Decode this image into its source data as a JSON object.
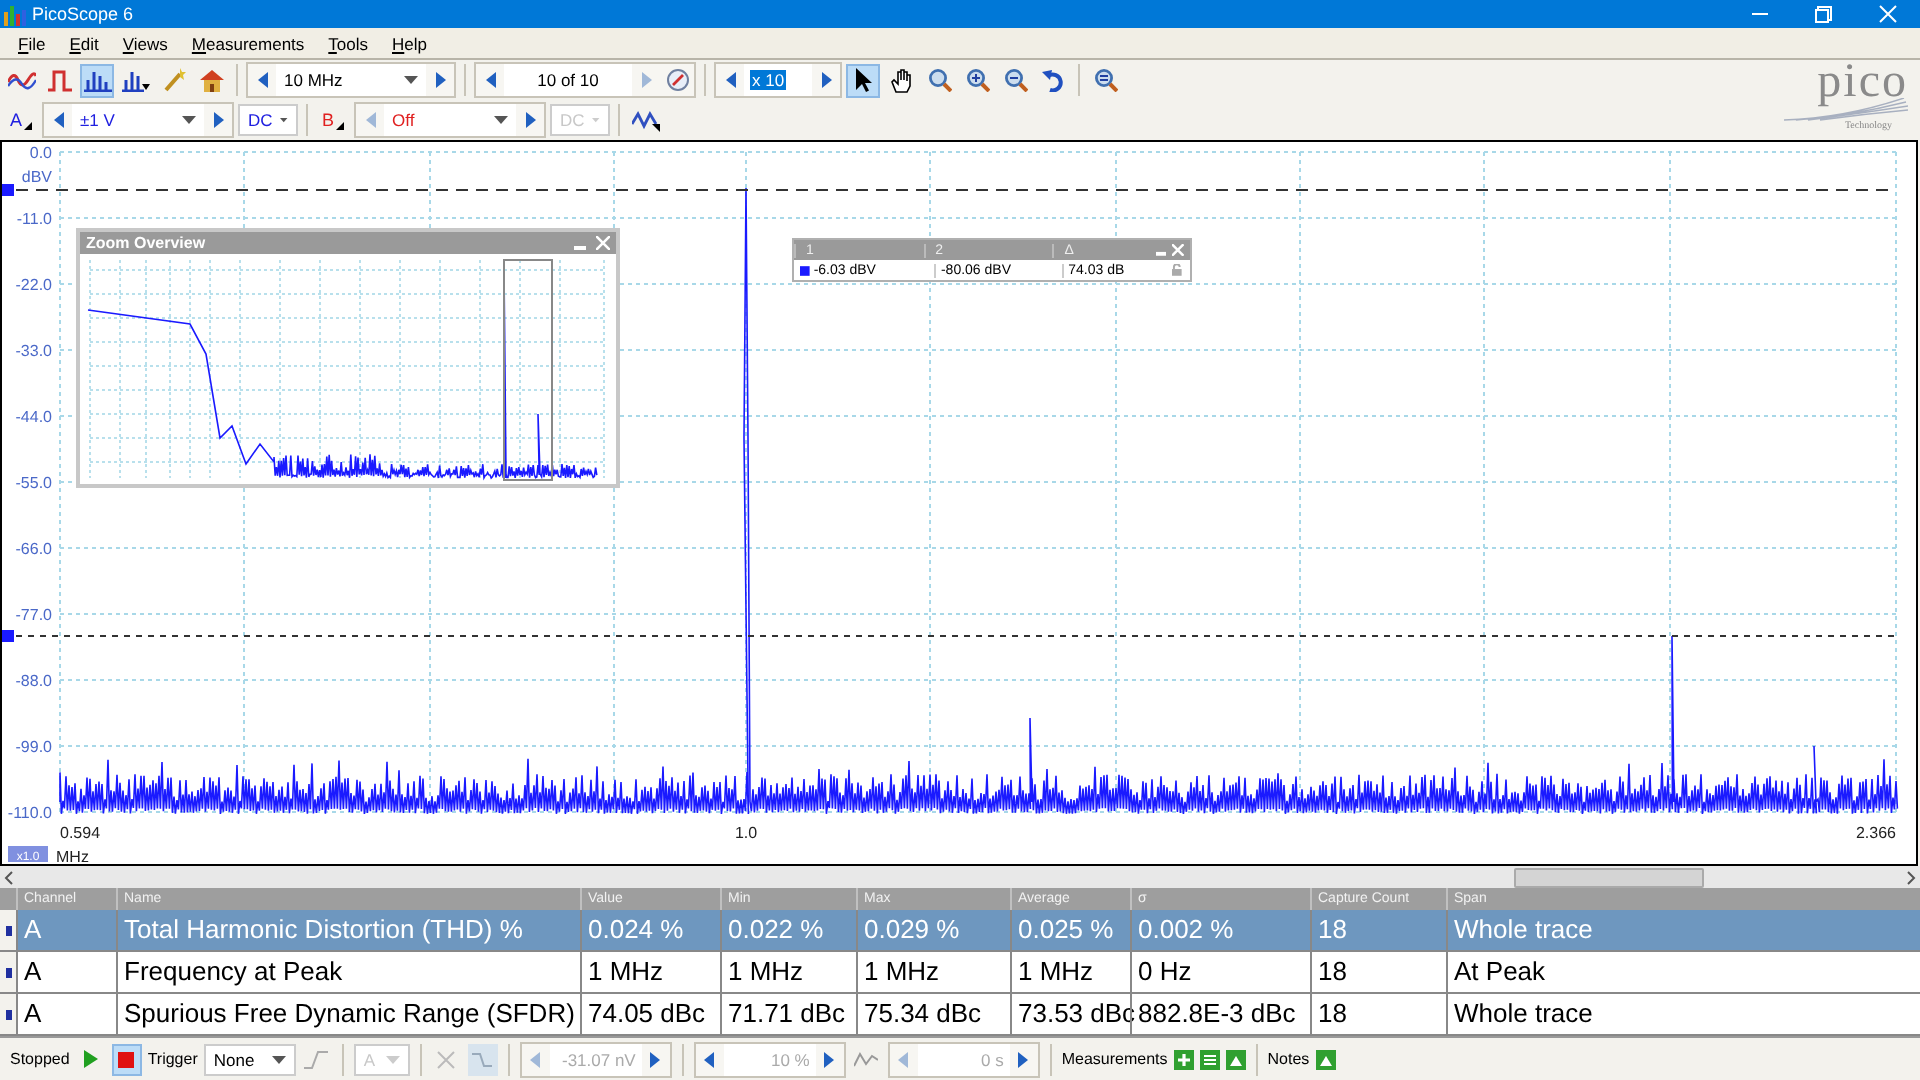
{
  "window": {
    "title": "PicoScope 6"
  },
  "menu": [
    "File",
    "Edit",
    "Views",
    "Measurements",
    "Tools",
    "Help"
  ],
  "toolbar": {
    "view_modes": [
      {
        "kind": "scope",
        "selected": false
      },
      {
        "kind": "xy",
        "selected": false
      },
      {
        "kind": "spectrum",
        "selected": true
      },
      {
        "kind": "spectrum_add",
        "selected": false
      },
      {
        "kind": "wand",
        "selected": false
      },
      {
        "kind": "home",
        "selected": false
      }
    ],
    "samples": "10 MHz",
    "buffer": "10 of 10",
    "zoom": "x 10",
    "tools": [
      {
        "kind": "pointer",
        "selected": true
      },
      {
        "kind": "hand",
        "selected": false
      },
      {
        "kind": "zoom",
        "selected": false
      },
      {
        "kind": "zoom_in",
        "selected": false
      },
      {
        "kind": "zoom_out",
        "selected": false
      },
      {
        "kind": "undo",
        "selected": false
      },
      {
        "kind": "zoom_fit",
        "selected": false
      }
    ]
  },
  "channels": [
    {
      "label": "A",
      "color": "#2020e0",
      "range": "±1 V",
      "coupling": "DC",
      "enabled": true
    },
    {
      "label": "B",
      "color": "#e02020",
      "range": "Off",
      "coupling": "DC",
      "enabled": false
    }
  ],
  "logo": {
    "name": "pico",
    "tagline": "Technology"
  },
  "spectrum": {
    "y_unit": "dBV",
    "y_ticks": [
      "0.0",
      "-11.0",
      "-22.0",
      "-33.0",
      "-44.0",
      "-55.0",
      "-66.0",
      "-77.0",
      "-88.0",
      "-99.0",
      "-110.0"
    ],
    "x_ticks": [
      "0.594",
      "1.0",
      "2.366"
    ],
    "x_scale": "x1.0",
    "x_unit": "MHz"
  },
  "zoom_overview": {
    "title": "Zoom Overview"
  },
  "rulers": {
    "columns": [
      "1",
      "2",
      "Δ"
    ],
    "values": [
      "-6.03 dBV",
      "-80.06 dBV",
      "74.03 dB"
    ]
  },
  "measurements": {
    "columns": [
      "Channel",
      "Name",
      "Value",
      "Min",
      "Max",
      "Average",
      "σ",
      "Capture Count",
      "Span"
    ],
    "rows": [
      {
        "selected": true,
        "cells": [
          "A",
          "Total Harmonic Distortion (THD) %",
          "0.024 %",
          "0.022 %",
          "0.029 %",
          "0.025 %",
          "0.002 %",
          "18",
          "Whole trace"
        ]
      },
      {
        "selected": false,
        "cells": [
          "A",
          "Frequency at Peak",
          "1 MHz",
          "1 MHz",
          "1 MHz",
          "1 MHz",
          "0 Hz",
          "18",
          "At Peak"
        ]
      },
      {
        "selected": false,
        "cells": [
          "A",
          "Spurious Free Dynamic Range (SFDR)",
          "74.05 dBc",
          "71.71 dBc",
          "75.34 dBc",
          "73.53 dBc",
          "882.8E-3 dBc",
          "18",
          "Whole trace"
        ]
      }
    ]
  },
  "status_bar": {
    "state": "Stopped",
    "running": false,
    "trigger_label": "Trigger",
    "trigger_mode": "None",
    "trigger_channel": "A",
    "threshold": "-31.07 nV",
    "pre_trigger": "10 %",
    "delay": "0 s",
    "measurements_label": "Measurements",
    "notes_label": "Notes"
  }
}
